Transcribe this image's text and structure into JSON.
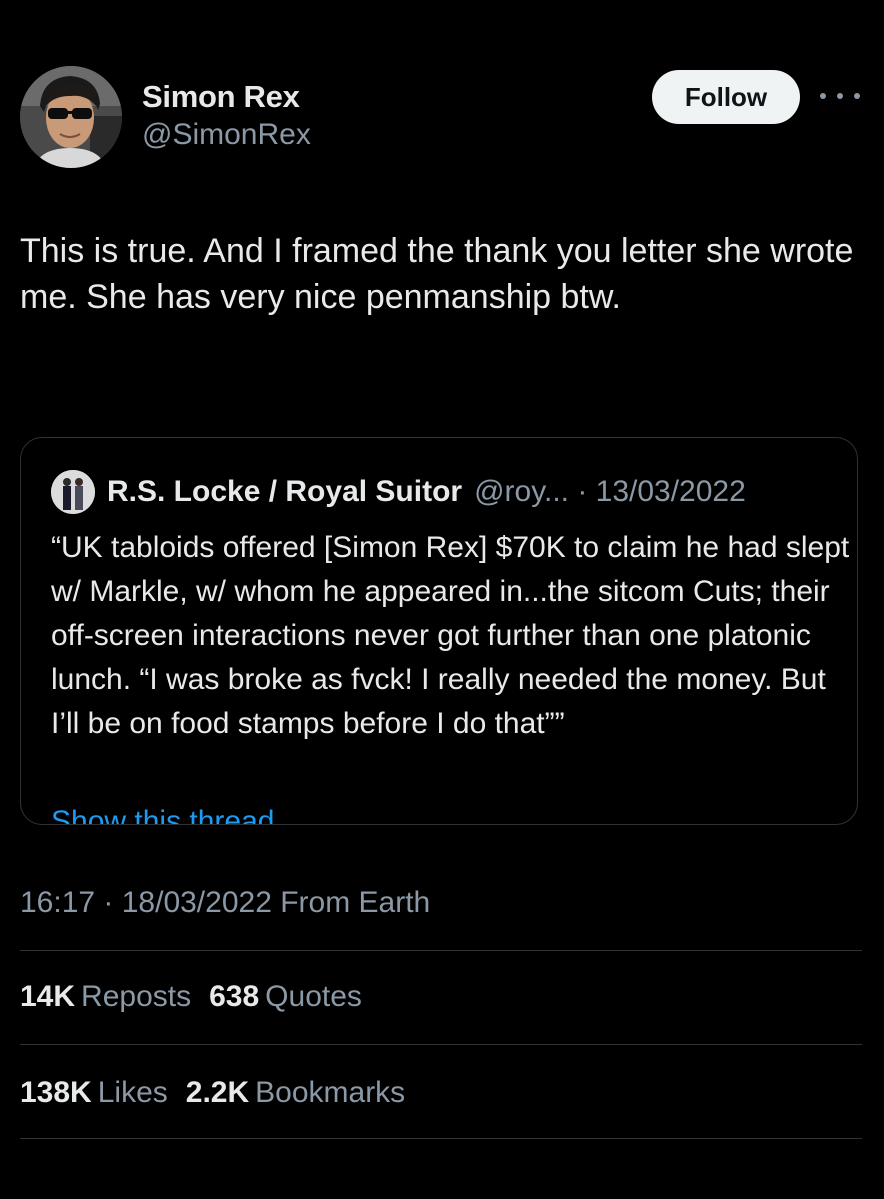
{
  "author": {
    "display_name": "Simon Rex",
    "handle": "@SimonRex",
    "avatar_icon": "profile-photo-sunglasses"
  },
  "follow_button": {
    "label": "Follow"
  },
  "more_icon": "more-horizontal-icon",
  "tweet": {
    "text": "This is true. And I framed the thank you letter she wrote me. She has very nice penmanship btw."
  },
  "quoted_tweet": {
    "display_name": "R.S. Locke / Royal Suitor",
    "meta": "@roy... · 13/03/2022",
    "text": "“UK tabloids offered [Simon Rex] $70K to claim he had slept w/ Markle, w/ whom he appeared in...the sitcom Cuts; their off-screen interactions never got further than one platonic lunch. “I was broke as fvck! I really needed the money. But I’ll be on food stamps before I do that””",
    "show_thread_label": "Show this thread"
  },
  "timestamp": "16:17 · 18/03/2022 From Earth",
  "stats": {
    "reposts_count": "14K",
    "reposts_label": "Reposts",
    "quotes_count": "638",
    "quotes_label": "Quotes",
    "likes_count": "138K",
    "likes_label": "Likes",
    "bookmarks_count": "2.2K",
    "bookmarks_label": "Bookmarks"
  },
  "colors": {
    "background": "#000000",
    "text_primary": "#e7e9ea",
    "text_secondary": "#8b98a5",
    "link": "#1d9bf0",
    "border": "#2f3336",
    "follow_bg": "#eff3f4"
  }
}
